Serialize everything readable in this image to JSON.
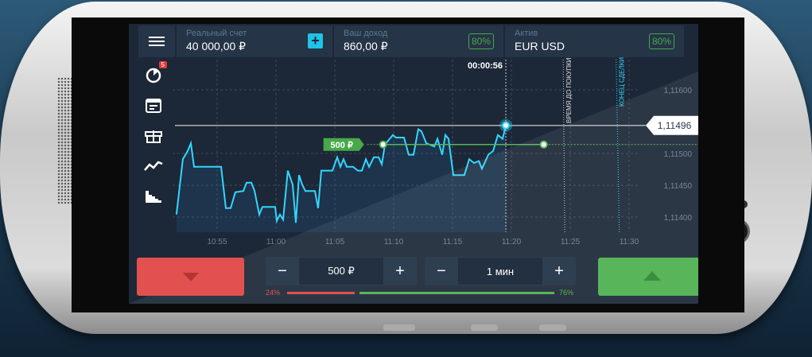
{
  "header": {
    "menu": "menu-icon",
    "account": {
      "label": "Реальный счет",
      "value": "40 000,00 ₽",
      "add": "+"
    },
    "income": {
      "label": "Ваш доход",
      "value": "860,00 ₽",
      "pct": "80%"
    },
    "asset": {
      "label": "Актив",
      "value": "EUR USD",
      "pct": "80%"
    }
  },
  "sidebar": {
    "badge": "5",
    "icons": [
      "pie-chart-icon",
      "calendar-icon",
      "gift-icon",
      "line-chart-icon",
      "candles-icon"
    ]
  },
  "timer": "00:00:56",
  "markers": {
    "purchase": "ВРЕМЯ ДО ПОКУПКИ",
    "end": "КОНЕЦ СДЕЛКИ"
  },
  "current_price": "1,11496",
  "bet_tag": "500 ₽",
  "controls": {
    "amount": "500 ₽",
    "duration": "1 мин",
    "minus": "−",
    "plus": "+"
  },
  "sentiment": {
    "down": "24%",
    "up": "76%",
    "down_value": 24,
    "up_value": 76
  },
  "colors": {
    "line": "#33d6ff",
    "down": "#e35050",
    "up": "#58b55a"
  },
  "chart_data": {
    "type": "line",
    "x_unit": "minutes after 10:55",
    "xticks": [
      "10:55",
      "11:00",
      "11:05",
      "11:10",
      "11:15",
      "11:20",
      "11:25",
      "11:30"
    ],
    "yticks": [
      "1,11600",
      "1,11500",
      "1,11450",
      "1,11400"
    ],
    "t": [
      -3.45,
      -2.91,
      -2.5,
      -2.23,
      -1.96,
      0.34,
      0.74,
      1.15,
      1.55,
      2.23,
      2.5,
      2.91,
      3.18,
      3.58,
      3.85,
      4.93,
      5.07,
      5.34,
      5.61,
      6.01,
      6.42,
      6.69,
      6.96,
      7.23,
      7.5,
      8.31,
      8.58,
      8.85,
      9.8,
      10.2,
      10.47,
      10.74,
      11.01,
      11.55,
      11.96,
      12.3,
      12.64,
      12.91,
      13.31,
      13.72,
      13.99,
      14.26,
      14.66,
      14.93,
      15.2,
      15.88,
      16.28,
      16.69,
      17.09,
      17.36,
      17.77,
      18.45,
      18.72,
      19.12,
      19.39,
      19.66,
      20.07,
      21.01,
      21.42,
      21.82,
      22.23,
      22.5,
      23.04,
      23.45,
      23.85,
      24.26,
      24.53
    ],
    "price": [
      1.11404,
      1.11491,
      1.11504,
      1.11516,
      1.11479,
      1.11479,
      1.11414,
      1.11414,
      1.11439,
      1.11441,
      1.11454,
      1.11454,
      1.11441,
      1.11404,
      1.11416,
      1.11416,
      1.11394,
      1.11404,
      1.11396,
      1.11473,
      1.11451,
      1.11391,
      1.11466,
      1.11451,
      1.11441,
      1.11441,
      1.11414,
      1.11473,
      1.11473,
      1.11494,
      1.11479,
      1.11491,
      1.11479,
      1.11479,
      1.11473,
      1.11473,
      1.11491,
      1.11479,
      1.11494,
      1.11494,
      1.11483,
      1.11514,
      1.11523,
      1.11529,
      1.11525,
      1.11525,
      1.11498,
      1.11498,
      1.11538,
      1.11535,
      1.11516,
      1.11511,
      1.11523,
      1.11498,
      1.11529,
      1.11523,
      1.11466,
      1.11466,
      1.11491,
      1.11485,
      1.11488,
      1.11476,
      1.11498,
      1.11504,
      1.11529,
      1.11523,
      1.11544
    ],
    "entry": {
      "t_start": 14.1,
      "t_end": 27.75,
      "price": 1.11514
    },
    "purchase_t": 29.4,
    "end_t": 33.9
  }
}
